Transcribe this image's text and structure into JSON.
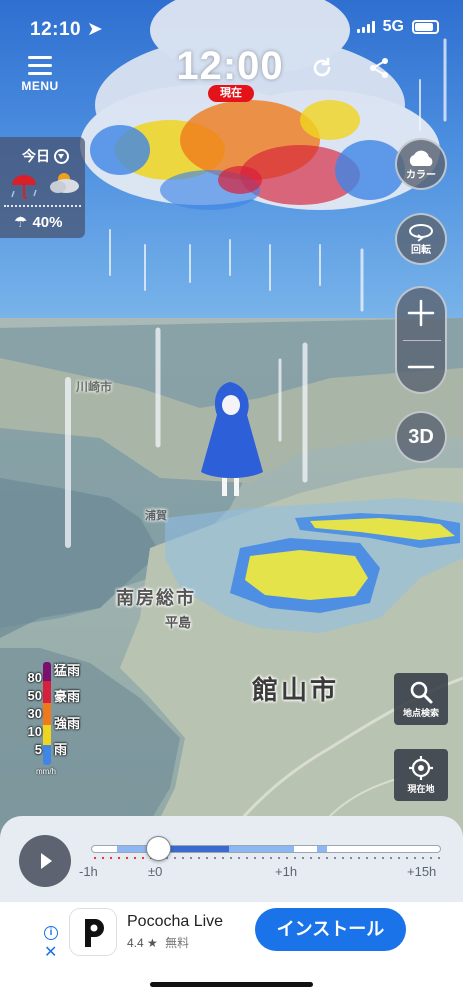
{
  "status_bar": {
    "time": "12:10",
    "network": "5G"
  },
  "menu": {
    "label": "MENU"
  },
  "clock": {
    "time": "12:00",
    "badge": "現在"
  },
  "forecast": {
    "day": "今日",
    "rain_chance": "40%"
  },
  "controls": {
    "color_label": "カラー",
    "rotate_label": "回転",
    "mode_3d": "3D",
    "search_label": "地点検索",
    "location_label": "現在地"
  },
  "legend": {
    "levels": [
      {
        "value": "80",
        "name": "猛雨",
        "color": "#7b0f6e"
      },
      {
        "value": "50",
        "name": "豪雨",
        "color": "#d7203b"
      },
      {
        "value": "30",
        "name": "強雨",
        "color": "#ef7a1c"
      },
      {
        "value": "10",
        "name": "雨",
        "color": "#f0d51e"
      },
      {
        "value": "5",
        "name": "",
        "color": "#3f86e6"
      }
    ],
    "unit": "mm/h"
  },
  "map_labels": {
    "city_main": "館山市",
    "city_south_boso": "南房総市",
    "area_heguri": "平島",
    "area_north": "川崎市",
    "area_ura": "浦賀"
  },
  "timeline": {
    "ticks": [
      "-1h",
      "±0",
      "+1h",
      "+15h"
    ],
    "current_position": 0.19
  },
  "ad": {
    "title": "Pococha Live",
    "rating": "4.4 ★",
    "price": "無料",
    "cta": "インストール"
  },
  "colors": {
    "accent": "#1a73e8",
    "now_badge": "#e4131a"
  }
}
